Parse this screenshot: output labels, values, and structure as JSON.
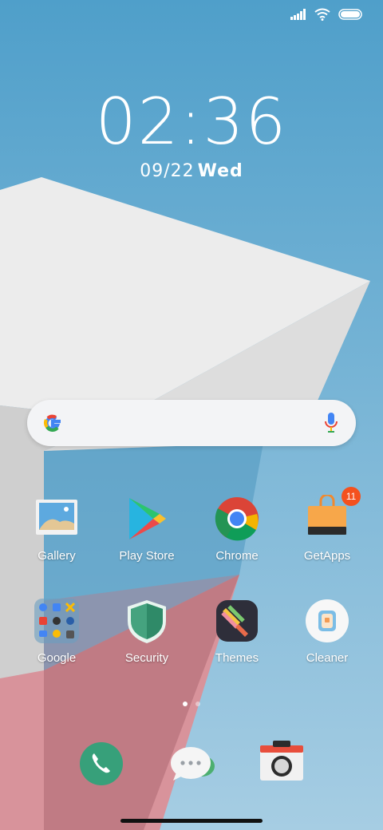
{
  "status": {
    "signal_icon": "signal-icon",
    "wifi_icon": "wifi-icon",
    "battery_icon": "battery-icon"
  },
  "lockclock": {
    "time": "02:36",
    "date": "09/22",
    "weekday": "Wed"
  },
  "search": {
    "logo": "google-g-icon",
    "mic": "mic-icon"
  },
  "apps": [
    {
      "label": "Gallery"
    },
    {
      "label": "Play Store"
    },
    {
      "label": "Chrome"
    },
    {
      "label": "GetApps",
      "badge": "11"
    },
    {
      "label": "Google"
    },
    {
      "label": "Security"
    },
    {
      "label": "Themes"
    },
    {
      "label": "Cleaner"
    }
  ],
  "pager": {
    "pages": 2,
    "current": 1
  },
  "dock": [
    {
      "name": "phone-icon"
    },
    {
      "name": "messages-icon"
    },
    {
      "name": "camera-icon"
    }
  ],
  "colors": {
    "sky": "#5fa9cf",
    "cube_light": "#e9e9e9",
    "pink": "#d98f98",
    "badge": "#f4511e"
  }
}
